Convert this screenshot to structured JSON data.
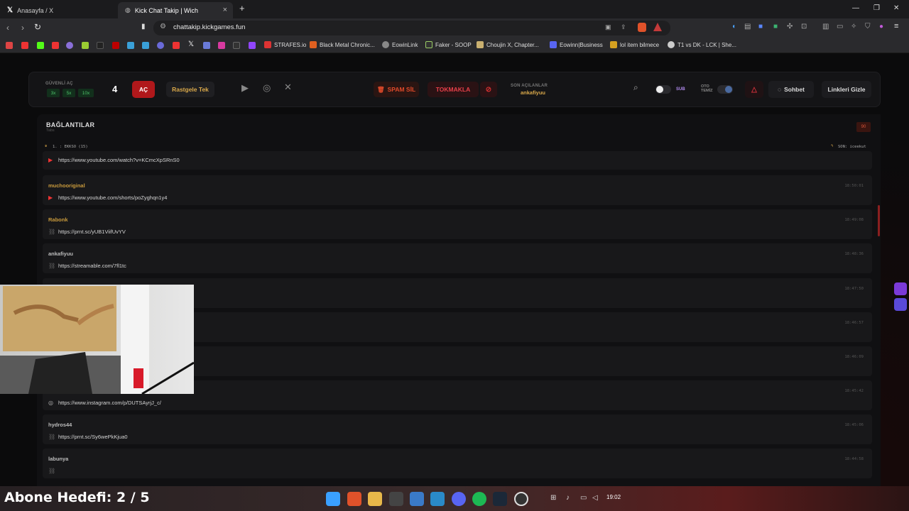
{
  "browser": {
    "tabs": [
      {
        "title": "Anasayfa / X",
        "icon": "x-logo-icon"
      },
      {
        "title": "Kick Chat Takip | Wich",
        "icon": "globe-icon",
        "active": true
      }
    ],
    "url": "chattakip.kickgames.fun",
    "bookmarks": [
      {
        "label": "STRAFES.io"
      },
      {
        "label": "Black Metal Chronic..."
      },
      {
        "label": "EowinLink"
      },
      {
        "label": "Faker - SOOP"
      },
      {
        "label": "Choujin X, Chapter..."
      },
      {
        "label": "Eowinn|Business"
      },
      {
        "label": "lol item bilmece"
      },
      {
        "label": "T1 vs DK - LCK | She..."
      }
    ]
  },
  "toolbar": {
    "safe_label": "GÜVENLİ AÇ",
    "multipliers": [
      "3x",
      "5x",
      "10x"
    ],
    "count": "4",
    "open_label": "AÇ",
    "random_label": "Rastgele Tek",
    "spam_label": "SPAM SİL",
    "hammer_label": "TOKMAKLA",
    "last_opened_label": "SON AÇILANLAR",
    "last_opened_user": "ankafiyuu",
    "sub_label": "SUB",
    "auto_clean_label_1": "OTO",
    "auto_clean_label_2": "TEMİZ",
    "chat_label": "Sohbet",
    "hide_links_label": "Linkleri Gizle"
  },
  "panel": {
    "title": "BAĞLANTILAR",
    "subtitle": "Tabs",
    "count": "90",
    "ticker_left": "1. : EKKSO (15)",
    "ticker_right": "SON: iceekut"
  },
  "links": [
    {
      "user": "",
      "url": "https://www.youtube.com/watch?v=KCmcXpSRnS0",
      "time": "",
      "icon": "youtube-icon"
    },
    {
      "user": "muchooriginal",
      "url": "https://www.youtube.com/shorts/poZyghqn1y4",
      "time": "18:50:01",
      "icon": "youtube-icon"
    },
    {
      "user": "Rabonk",
      "url": "https://prnt.sc/yUB1ViifUvYV",
      "time": "18:49:08",
      "icon": "link-icon"
    },
    {
      "user": "ankafiyuu",
      "url": "https://streamable.com/7fl1tc",
      "time": "18:48:36",
      "icon": "link-icon"
    },
    {
      "user": "",
      "url": "",
      "time": "18:47:50",
      "icon": ""
    },
    {
      "user": "",
      "url": "",
      "time": "18:46:57",
      "icon": ""
    },
    {
      "user": "",
      "url": "",
      "time": "18:46:09",
      "icon": ""
    },
    {
      "user": "",
      "url": "https://www.instagram.com/p/DUTSAyrjJ_c/",
      "time": "18:45:42",
      "icon": "instagram-icon"
    },
    {
      "user": "hydros44",
      "url": "https://prnt.sc/Sy6wePkKjua0",
      "time": "18:45:06",
      "icon": "link-icon"
    },
    {
      "user": "labunya",
      "url": "",
      "time": "18:44:58",
      "icon": "link-icon"
    }
  ],
  "overlay": {
    "goal_text": "Abone Hedefi:  2 / 5",
    "clock": "19:02"
  },
  "colors": {
    "accent_red": "#b0181b",
    "username_gold": "#c99a3c",
    "username_grey": "#bdbdbd"
  }
}
